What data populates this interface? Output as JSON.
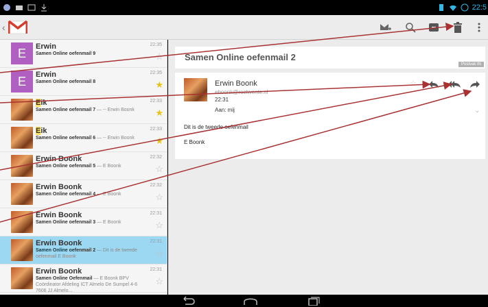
{
  "status_bar": {
    "time": "22:5"
  },
  "action_bar": {
    "app": "Gmail",
    "buttons": [
      "compose-icon",
      "search-icon",
      "archive-icon",
      "trash-icon",
      "overflow-icon"
    ]
  },
  "inbox": {
    "rows": [
      {
        "sender": "Erwin",
        "subject": "Samen Online oefenmail 9",
        "snippet": "",
        "time": "22:35",
        "avatar": "E",
        "starred": false
      },
      {
        "sender": "Erwin",
        "subject": "Samen Online oefenmail 8",
        "snippet": "",
        "time": "22:35",
        "avatar": "E",
        "starred": true
      },
      {
        "sender_hl": "E",
        "sender": "ik",
        "subject": "Samen Online oefenmail 7",
        "snippet": " — -- Erwin Boonk",
        "time": "22:33",
        "avatar": "",
        "starred": true
      },
      {
        "sender_hl": "E",
        "sender": "ik",
        "subject": "Samen Online oefenmail 6",
        "snippet": " — -- Erwin Boonk",
        "time": "22:33",
        "avatar": "",
        "starred": true
      },
      {
        "sender": "Erwin Boonk",
        "subject": "Samen Online oefenmail 5",
        "snippet": " — E Boonk",
        "time": "22:32",
        "avatar": "",
        "starred": false
      },
      {
        "sender": "Erwin Boonk",
        "subject": "Samen Online oefenmail 4",
        "snippet": " — E Boonk",
        "time": "22:32",
        "avatar": "",
        "starred": false
      },
      {
        "sender": "Erwin Boonk",
        "subject": "Samen Online oefenmail 3",
        "snippet": " — E Boonk",
        "time": "22:31",
        "avatar": "",
        "starred": false
      },
      {
        "sender": "Erwin Boonk",
        "subject": "Samen Online oefenmail 2",
        "snippet": " — Dit is de tweede oefenmail E Boonk",
        "time": "22:31",
        "avatar": "",
        "starred": false,
        "selected": true
      },
      {
        "sender": "Erwin Boonk",
        "subject": "Samen Online Oefenmail",
        "snippet": " — E Boonk BPV Coördinator Afdeling ICT Almelo De Sumpel 4-6 7606 JJ Almelo...",
        "time": "22:31",
        "avatar": "",
        "starred": false
      }
    ]
  },
  "detail": {
    "subject": "Samen Online oefenmail 2",
    "label": "Postvak IN",
    "message": {
      "from": "Erwin Boonk",
      "email": "eboonk@roctwente.nl",
      "time": "22:31",
      "to": "Aan: mij",
      "body_line1": "Dit is de tweede oefenmail",
      "body_line2": "E Boonk"
    },
    "message_actions": [
      "reply-icon",
      "reply-all-icon",
      "forward-icon"
    ]
  },
  "colors": {
    "accent": "#33b5e5",
    "selected_row": "#9cd8f2",
    "arrow": "#a83232",
    "letter_avatar": "#b060c0",
    "star_on": "#e6c21a"
  }
}
